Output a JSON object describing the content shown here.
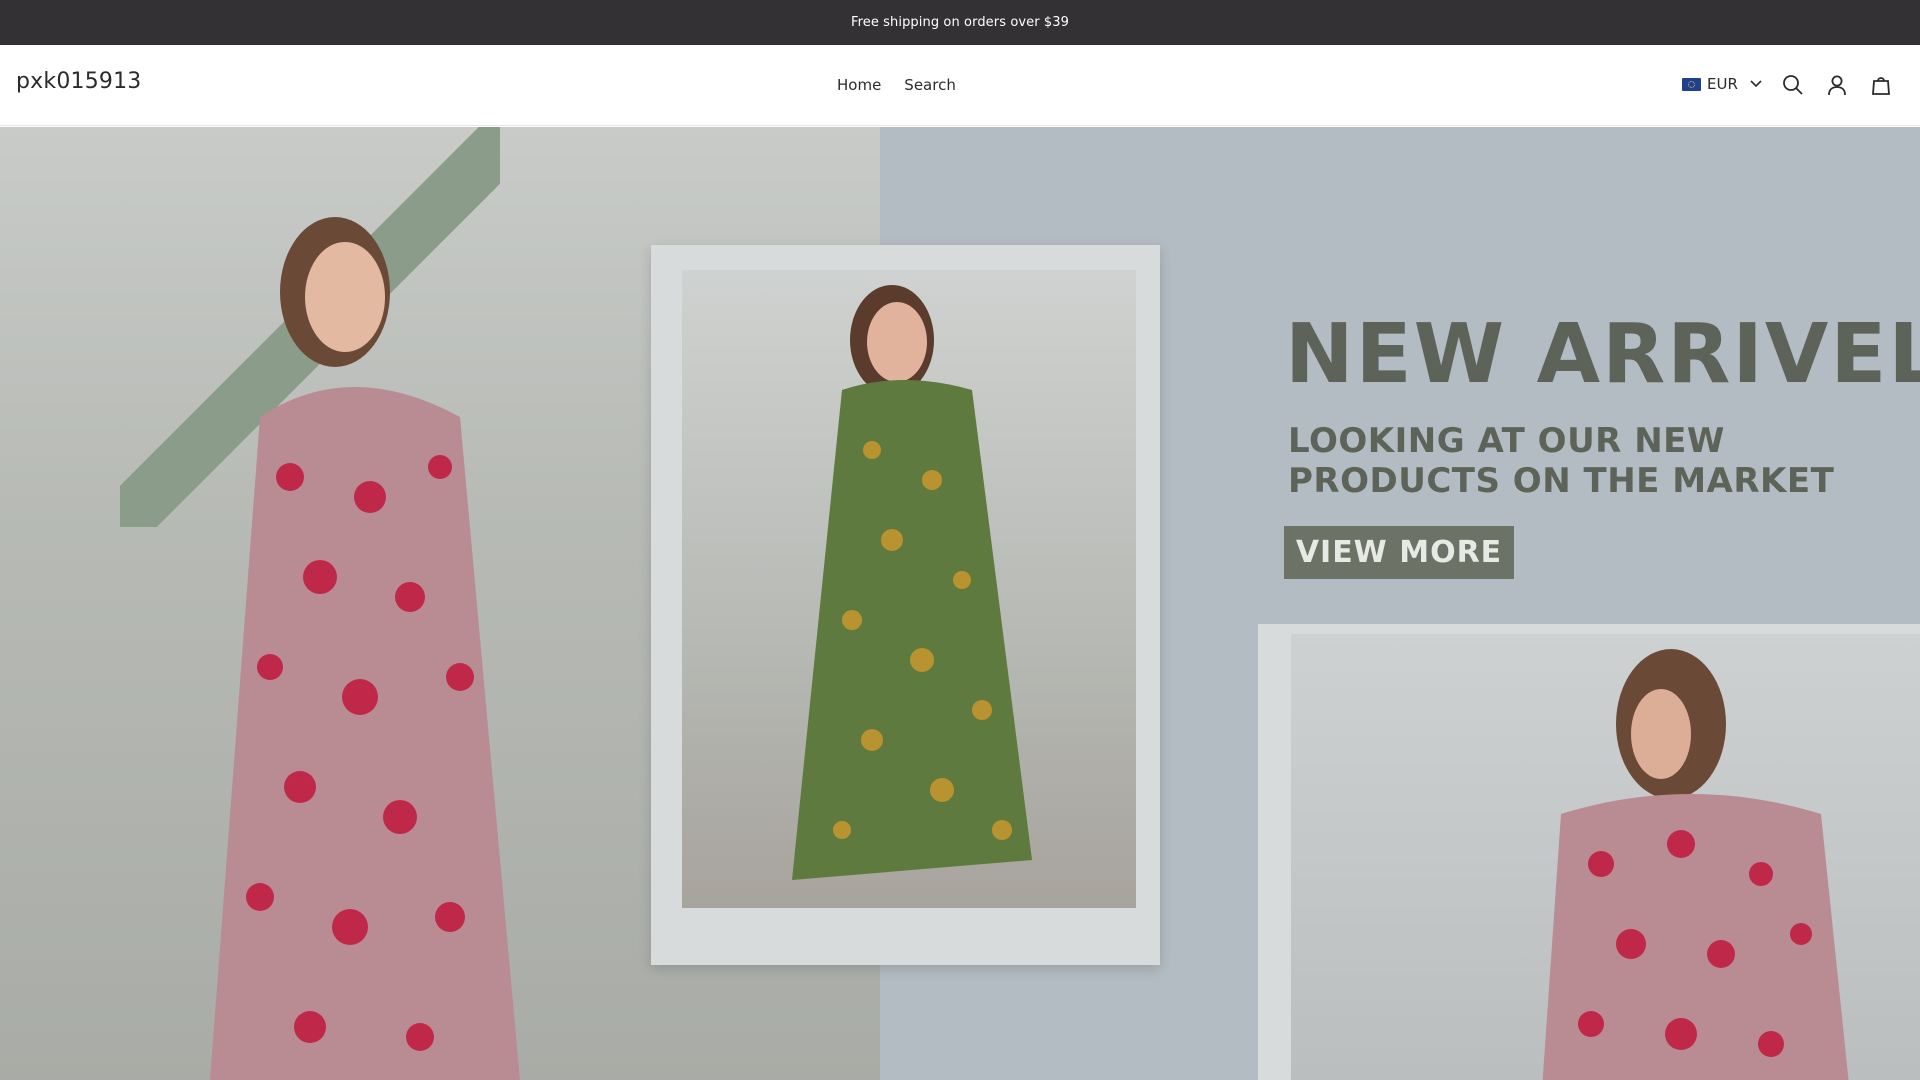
{
  "announcement": {
    "text": "Free shipping on orders over $39"
  },
  "header": {
    "logo": "pxk015913",
    "nav": [
      {
        "label": "Home"
      },
      {
        "label": "Search"
      }
    ],
    "currency": {
      "code": "EUR",
      "flag_icon": "eu-flag-icon"
    },
    "icons": [
      "search-icon",
      "account-icon",
      "cart-icon"
    ]
  },
  "hero": {
    "headline": "NEW ARRIVEL",
    "subheadline": "LOOKING AT OUR NEW PRODUCTS ON THE MARKET",
    "cta": "VIEW MORE"
  },
  "colors": {
    "announcement_bg": "#333134",
    "text": "#2b2b2b",
    "hero_text": "#5e6359",
    "cta_bg": "#6c7265",
    "dress_red": "#c0284a",
    "dress_green": "#5f7a3e"
  }
}
